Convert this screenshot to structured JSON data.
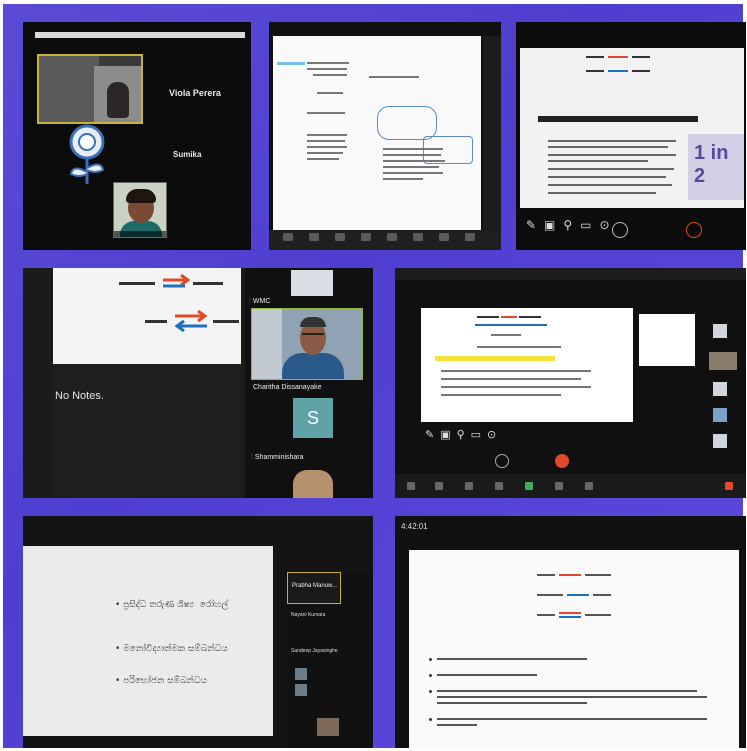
{
  "colors": {
    "collage_border": "#5a4bd6",
    "accent_red": "#e04a2a",
    "accent_blue": "#1f6fbf",
    "highlight": "#f5e23a",
    "active_speaker": "#8db83b"
  },
  "panel1": {
    "participant_1": "Viola Perera",
    "participant_2": "Sumika",
    "icon": "flower-icon"
  },
  "panel4": {
    "speaker_name": "Charitha Dissanayake",
    "tag": "WMC",
    "notes_label": "No Notes.",
    "tile_letter": "S",
    "tile_name": "Shamminishara"
  },
  "panel3": {
    "poster_text": "1 in 2"
  },
  "panel6": {
    "bullets": [
      "• ප්‍රසිද්ධ තරුණ ශිෂ්‍ය  රෝහල්",
      "• මනෝවිද්‍යාත්මක සම්බන්ධය",
      "• පරිභෝජන සම්බන්ධය"
    ],
    "selected_participant": "Prabha Manuw...",
    "participants": [
      "Nayani Kumara",
      "Sandeep Jayasinghe"
    ]
  },
  "panel7": {
    "time": "4:42:01"
  }
}
